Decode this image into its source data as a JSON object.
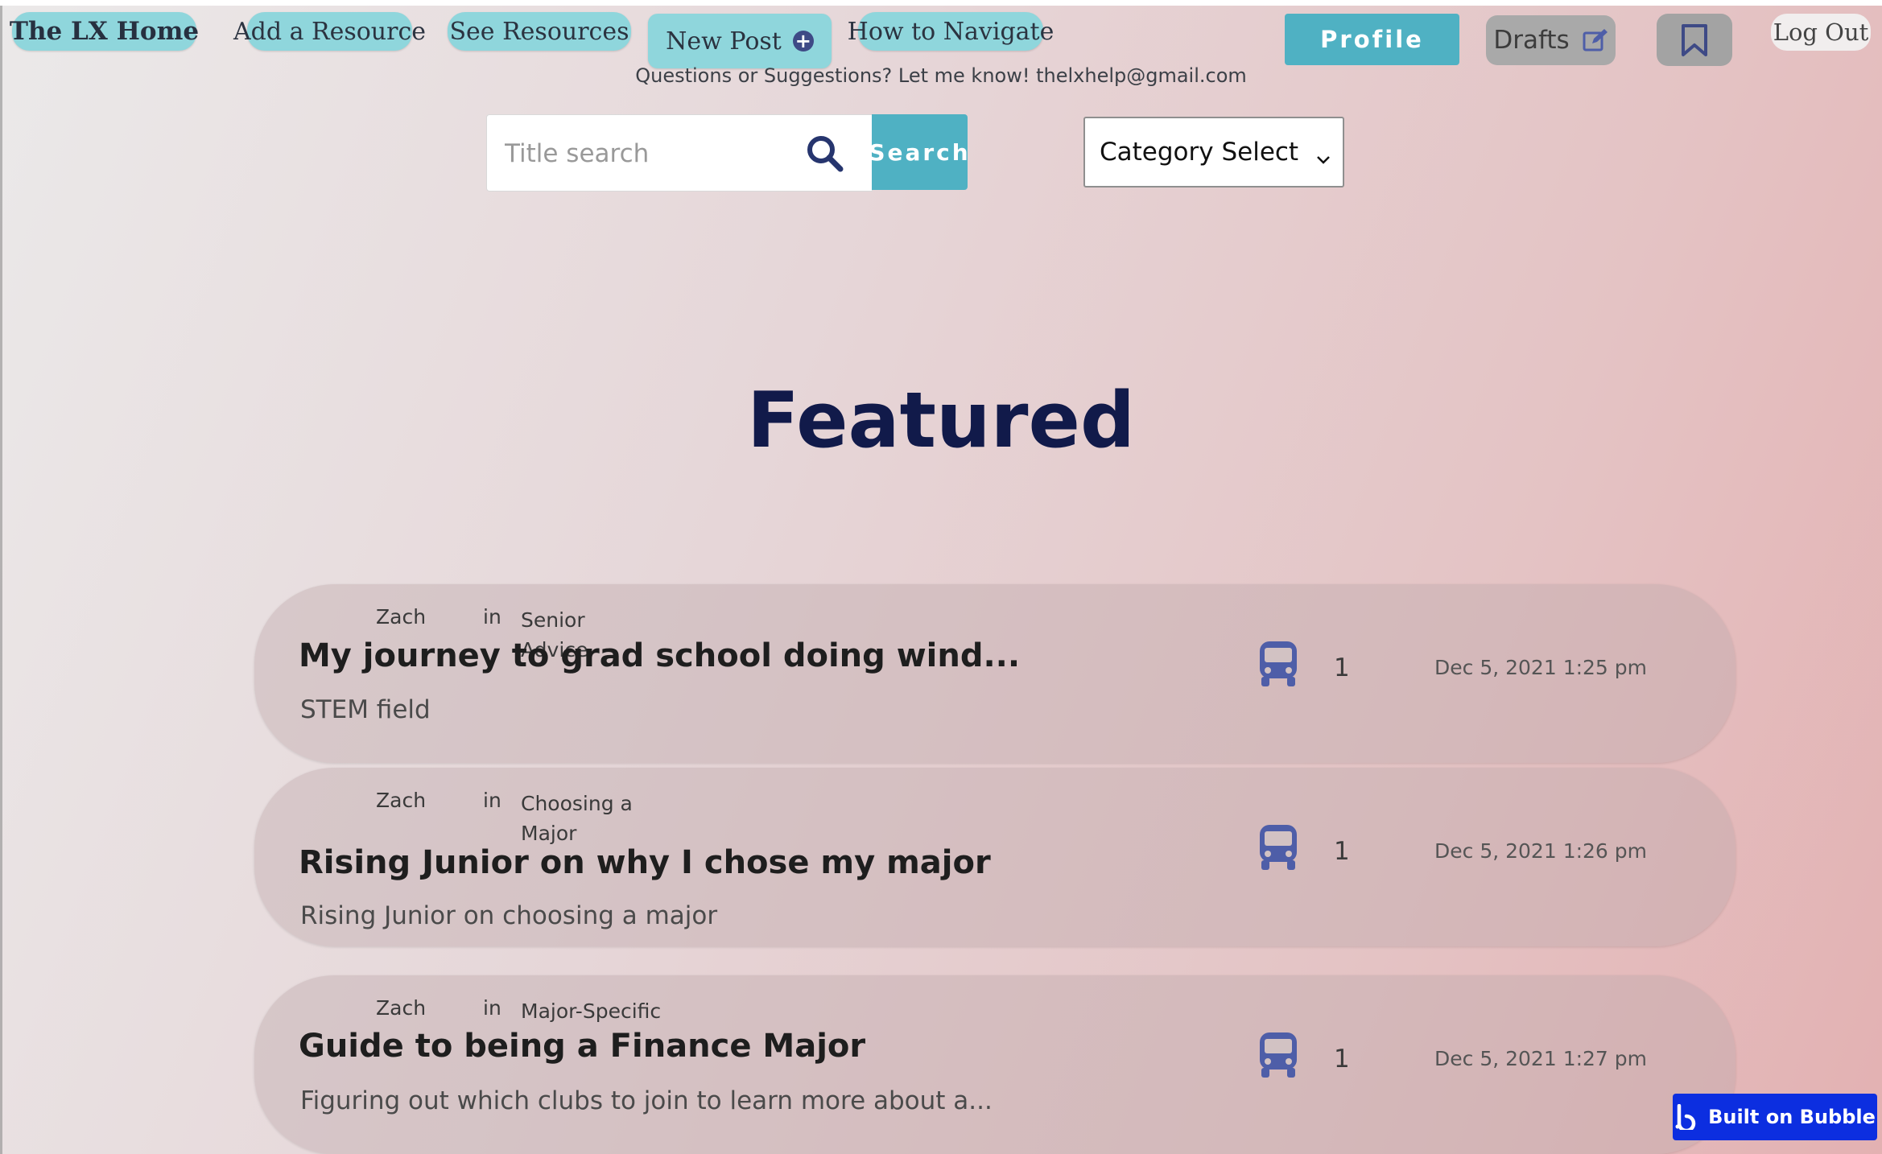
{
  "nav": {
    "home": "The LX Home",
    "add_resource": "Add a Resource",
    "see_resources": "See Resources",
    "new_post": "New Post",
    "how_to_navigate": "How to Navigate",
    "profile": "Profile",
    "drafts": "Drafts",
    "log_out": "Log Out"
  },
  "contact_text": "Questions or Suggestions? Let me know! thelxhelp@gmail.com",
  "search": {
    "placeholder": "Title search",
    "button": "Search"
  },
  "category_select": "Category Select",
  "heading": "Featured",
  "posts": [
    {
      "author": "Zach",
      "in": "in",
      "category": "Senior Advice",
      "title": "My journey to grad school doing wind...",
      "description": "STEM field",
      "count": "1",
      "date": "Dec 5, 2021 1:25 pm"
    },
    {
      "author": "Zach",
      "in": "in",
      "category": "Choosing a Major",
      "title": "Rising Junior on why I chose my major",
      "description": "Rising Junior on choosing a major",
      "count": "1",
      "date": "Dec 5, 2021 1:26 pm"
    },
    {
      "author": "Zach",
      "in": "in",
      "category": "Major-Specific",
      "title": "Guide to being a Finance Major",
      "description": "Figuring out which clubs to join to learn more about a...",
      "count": "1",
      "date": "Dec 5, 2021 1:27 pm"
    }
  ],
  "badge": "Built on Bubble",
  "icons": {
    "new_post": "plus-circle-icon",
    "drafts": "edit-icon",
    "bookmark": "bookmark-icon",
    "search": "search-icon",
    "category": "chevron-down-icon",
    "post": "bus-icon"
  },
  "colors": {
    "nav_pill": "#8fd6dc",
    "accent": "#4fb1c3",
    "heading": "#111a4a",
    "badge": "#0c2ee0",
    "icon": "#4e5ea8"
  }
}
